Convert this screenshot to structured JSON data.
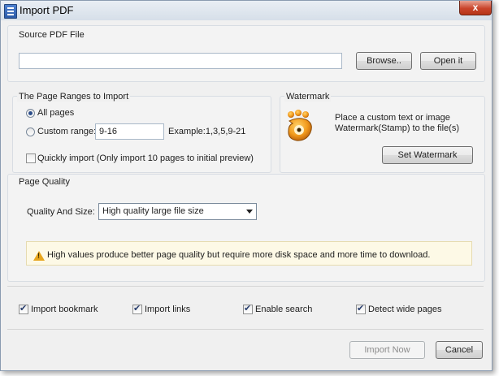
{
  "window": {
    "title": "Import PDF",
    "close_glyph": "x"
  },
  "source": {
    "group_title": "Source PDF File",
    "path_value": "",
    "browse_label": "Browse..",
    "open_label": "Open it"
  },
  "ranges": {
    "group_title": "The Page Ranges to Import",
    "all_pages_label": "All pages",
    "all_pages_selected": true,
    "custom_label": "Custom range:",
    "custom_value": "9-16",
    "example_text": "Example:1,3,5,9-21",
    "quick_label": "Quickly import (Only import 10 pages to  initial  preview)",
    "quick_checked": false
  },
  "watermark": {
    "group_title": "Watermark",
    "description_line1": "Place a custom text or image",
    "description_line2": "Watermark(Stamp) to the file(s)",
    "button_label": "Set Watermark",
    "icon": "gimp-mascot-icon"
  },
  "quality": {
    "group_title": "Page Quality",
    "label": "Quality And Size:",
    "selected_option": "High quality large file size",
    "info_text": "High values produce better page quality but require more disk space and more time to download."
  },
  "options": [
    {
      "label": "Import bookmark",
      "checked": true
    },
    {
      "label": "Import links",
      "checked": true
    },
    {
      "label": "Enable search",
      "checked": true
    },
    {
      "label": "Detect wide pages",
      "checked": true
    }
  ],
  "footer": {
    "import_label": "Import Now",
    "cancel_label": "Cancel"
  },
  "colors": {
    "accent": "#2b4d8a",
    "warning": "#e7a51e",
    "info_bg": "#fdf9e6"
  }
}
